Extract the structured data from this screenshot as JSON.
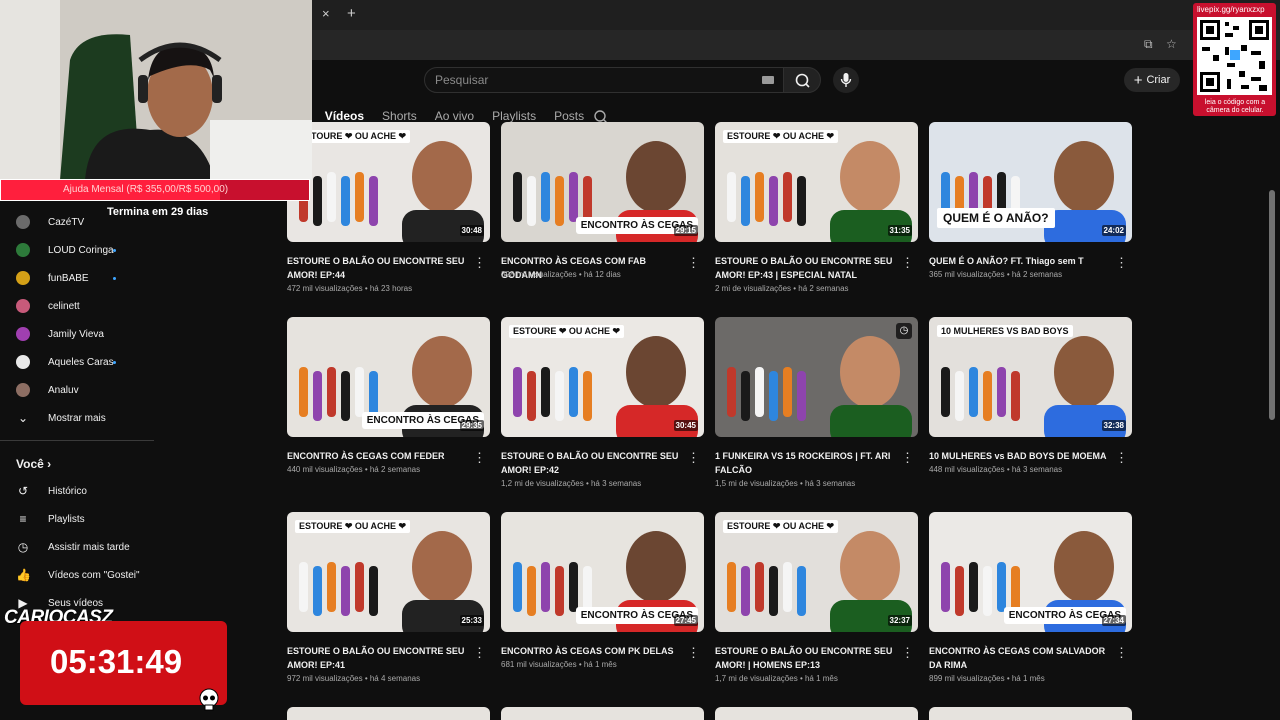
{
  "browser": {
    "tab_close": "×",
    "tab_new": "+"
  },
  "header": {
    "search_placeholder": "Pesquisar",
    "create_label": "Criar"
  },
  "channel_tabs": [
    "o",
    "Vídeos",
    "Shorts",
    "Ao vivo",
    "Playlists",
    "Posts"
  ],
  "sidebar": {
    "subscriptions": [
      {
        "name": "CazéTV",
        "avatar_color": "#6b6b6b",
        "dot": false
      },
      {
        "name": "LOUD Coringa",
        "avatar_color": "#2d7a3a",
        "dot": true
      },
      {
        "name": "funBABE",
        "avatar_color": "#d4a017",
        "dot": true
      },
      {
        "name": "celinett",
        "avatar_color": "#c75a7a",
        "dot": false
      },
      {
        "name": "Jamily Vieva",
        "avatar_color": "#a03fb0",
        "dot": false
      },
      {
        "name": "Aqueles Caras",
        "avatar_color": "#e8e8e8",
        "dot": true
      },
      {
        "name": "Analuv",
        "avatar_color": "#8d6e63",
        "dot": false
      }
    ],
    "show_more": "Mostrar mais",
    "you_title": "Você",
    "you_items": [
      {
        "label": "Histórico",
        "icon": "history-icon"
      },
      {
        "label": "Playlists",
        "icon": "playlists-icon"
      },
      {
        "label": "Assistir mais tarde",
        "icon": "watch-later-icon"
      },
      {
        "label": "Vídeos com \"Gostei\"",
        "icon": "like-icon"
      },
      {
        "label": "Seus vídeos",
        "icon": "your-videos-icon"
      }
    ]
  },
  "videos": [
    {
      "title": "ESTOURE O BALÃO OU ENCONTRE SEU AMOR! EP:44",
      "views": "472 mil visualizações",
      "age": "há 23 horas",
      "duration": "30:48",
      "badge": "ESTOURE ❤ OU ACHE ❤",
      "bg": "#e9e6e3"
    },
    {
      "title": "ENCONTRO ÀS CEGAS COM FAB GODAMN",
      "views": "398 mil visualizações",
      "age": "há 12 dias",
      "duration": "29:15",
      "badge": "ENCONTRO ÀS CEGAS",
      "bg": "#d9d6d0"
    },
    {
      "title": "ESTOURE O BALÃO OU ENCONTRE SEU AMOR! EP:43 | ESPECIAL NATAL",
      "views": "2 mi de visualizações",
      "age": "há 2 semanas",
      "duration": "31:35",
      "badge": "ESTOURE ❤ OU ACHE ❤",
      "bg": "#e4e1dc"
    },
    {
      "title": "QUEM É O ANÃO? FT. Thiago sem T",
      "views": "365 mil visualizações",
      "age": "há 2 semanas",
      "duration": "24:02",
      "badge": "QUEM É O ANÃO?",
      "bg": "#dde3ea"
    },
    {
      "title": "ENCONTRO ÀS CEGAS COM FEDER",
      "views": "440 mil visualizações",
      "age": "há 2 semanas",
      "duration": "29:35",
      "badge": "ENCONTRO ÀS CEGAS",
      "bg": "#e6e3de"
    },
    {
      "title": "ESTOURE O BALÃO OU ENCONTRE SEU AMOR! EP:42",
      "views": "1,2 mi de visualizações",
      "age": "há 3 semanas",
      "duration": "30:45",
      "badge": "ESTOURE ❤ OU ACHE ❤",
      "bg": "#ebe8e4"
    },
    {
      "title": "1 FUNKEIRA VS 15 ROCKEIROS | FT. ARI FALCÃO",
      "views": "1,5 mi de visualizações",
      "age": "há 3 semanas",
      "duration": "",
      "badge": "",
      "bg": "#6c6a68"
    },
    {
      "title": "10 MULHERES vs BAD BOYS DE MOEMA",
      "views": "448 mil visualizações",
      "age": "há 3 semanas",
      "duration": "32:38",
      "badge": "10 MULHERES VS BAD BOYS",
      "bg": "#e3e0dc"
    },
    {
      "title": "ESTOURE O BALÃO OU ENCONTRE SEU AMOR! EP:41",
      "views": "972 mil visualizações",
      "age": "há 4 semanas",
      "duration": "25:33",
      "badge": "ESTOURE ❤ OU ACHE ❤",
      "bg": "#e8e5e1"
    },
    {
      "title": "ENCONTRO ÀS CEGAS COM PK DELAS",
      "views": "681 mil visualizações",
      "age": "há 1 mês",
      "duration": "27:45",
      "badge": "ENCONTRO ÀS CEGAS",
      "bg": "#e7e4df"
    },
    {
      "title": "ESTOURE O BALÃO OU ENCONTRE SEU AMOR! | HOMENS EP:13",
      "views": "1,7 mi de visualizações",
      "age": "há 1 mês",
      "duration": "32:37",
      "badge": "ESTOURE ❤ OU ACHE ❤",
      "bg": "#e2dfdb"
    },
    {
      "title": "ENCONTRO ÀS CEGAS COM SALVADOR DA RIMA",
      "views": "899 mil visualizações",
      "age": "há 1 mês",
      "duration": "27:34",
      "badge": "ENCONTRO ÀS CEGAS",
      "bg": "#ebe9e6"
    }
  ],
  "overlay": {
    "goal_text": "Ajuda Mensal (R$ 355,00/R$ 500,00)",
    "goal_progress": 0.71,
    "goal_sub": "Termina em 29 dias",
    "qr_url": "livepix.gg/ryanxzxp",
    "qr_caption": "leia o código com a câmera do celular.",
    "brand": "CARIOCASZ",
    "timer": "05:31:49"
  }
}
